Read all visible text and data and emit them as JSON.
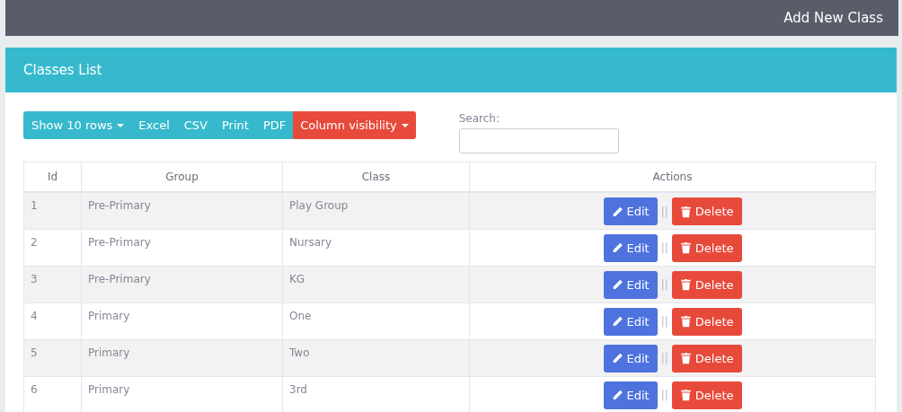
{
  "top_bar": {
    "action": "Add New Class"
  },
  "card": {
    "title": "Classes List"
  },
  "toolbar": {
    "buttons": [
      {
        "label": "Show 10 rows",
        "kind": "dropdown"
      },
      {
        "label": "Excel",
        "kind": "plain"
      },
      {
        "label": "CSV",
        "kind": "plain"
      },
      {
        "label": "Print",
        "kind": "plain"
      },
      {
        "label": "PDF",
        "kind": "plain"
      },
      {
        "label": "Column visibility",
        "kind": "danger-dropdown"
      }
    ]
  },
  "search": {
    "label": "Search:"
  },
  "table": {
    "columns": [
      "Id",
      "Group",
      "Class",
      "Actions"
    ],
    "rows": [
      {
        "id": "1",
        "group": "Pre-Primary",
        "class": "Play Group",
        "edit": "Edit",
        "separator": "||",
        "delete": "Delete"
      },
      {
        "id": "2",
        "group": "Pre-Primary",
        "class": "Nursary",
        "edit": "Edit",
        "separator": "||",
        "delete": "Delete"
      },
      {
        "id": "3",
        "group": "Pre-Primary",
        "class": "KG",
        "edit": "Edit",
        "separator": "||",
        "delete": "Delete"
      },
      {
        "id": "4",
        "group": "Primary",
        "class": "One",
        "edit": "Edit",
        "separator": "||",
        "delete": "Delete"
      },
      {
        "id": "5",
        "group": "Primary",
        "class": "Two",
        "edit": "Edit",
        "separator": "||",
        "delete": "Delete"
      },
      {
        "id": "6",
        "group": "Primary",
        "class": "3rd",
        "edit": "Edit",
        "separator": "||",
        "delete": "Delete"
      }
    ]
  }
}
